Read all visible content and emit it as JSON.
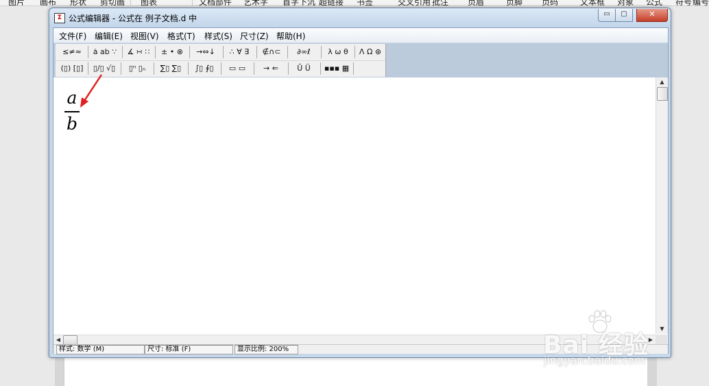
{
  "host": {
    "ribbon_items": [
      "图片",
      "画布",
      "形状",
      "剪切画",
      "图表",
      "文档部件",
      "艺术字",
      "首字下沉",
      "超链接",
      "书签",
      "交叉引用",
      "批注",
      "页眉",
      "页脚",
      "页码",
      "文本框",
      "对象",
      "公式",
      "符号",
      "编号"
    ]
  },
  "window": {
    "title": "公式编辑器 - 公式在 例子文档.d 中",
    "controls": {
      "minimize": "▭",
      "maximize": "▢",
      "close": "✕"
    }
  },
  "menu": {
    "items": [
      "文件(F)",
      "编辑(E)",
      "视图(V)",
      "格式(T)",
      "样式(S)",
      "尺寸(Z)",
      "帮助(H)"
    ]
  },
  "toolbar": {
    "row1": [
      "≤≠≈",
      "ȧ ab ∵",
      "∡ ∺ ∷",
      "± • ⊗",
      "→⇔↓",
      "∴ ∀ ∃",
      "∉∩⊂",
      "∂∞ℓ",
      "λ ω θ",
      "Λ Ω ⊛"
    ],
    "row2": [
      "(▯) [▯]",
      "▯/▯ √▯",
      "▯ⁿ ▯ₙ",
      "∑▯ ∑▯",
      "∫▯ ∮▯",
      "▭ ▭",
      "→ ⇐",
      "Ū Ü",
      "▪▪▪ ▦"
    ]
  },
  "editor": {
    "fraction": {
      "numerator": "a",
      "denominator": "b"
    }
  },
  "status": {
    "style": "样式: 数学 (M)",
    "size": "尺寸: 标准 (F)",
    "zoom": "显示比例: 200%"
  },
  "watermark": {
    "brand": "Bai 经验",
    "site": "jingyan.baidu.com"
  },
  "colors": {
    "annotation_arrow": "#e02020",
    "toolbar_backdrop": "#bccbdc",
    "title_bar": "#c7d8ea",
    "close_button": "#c53d28"
  }
}
